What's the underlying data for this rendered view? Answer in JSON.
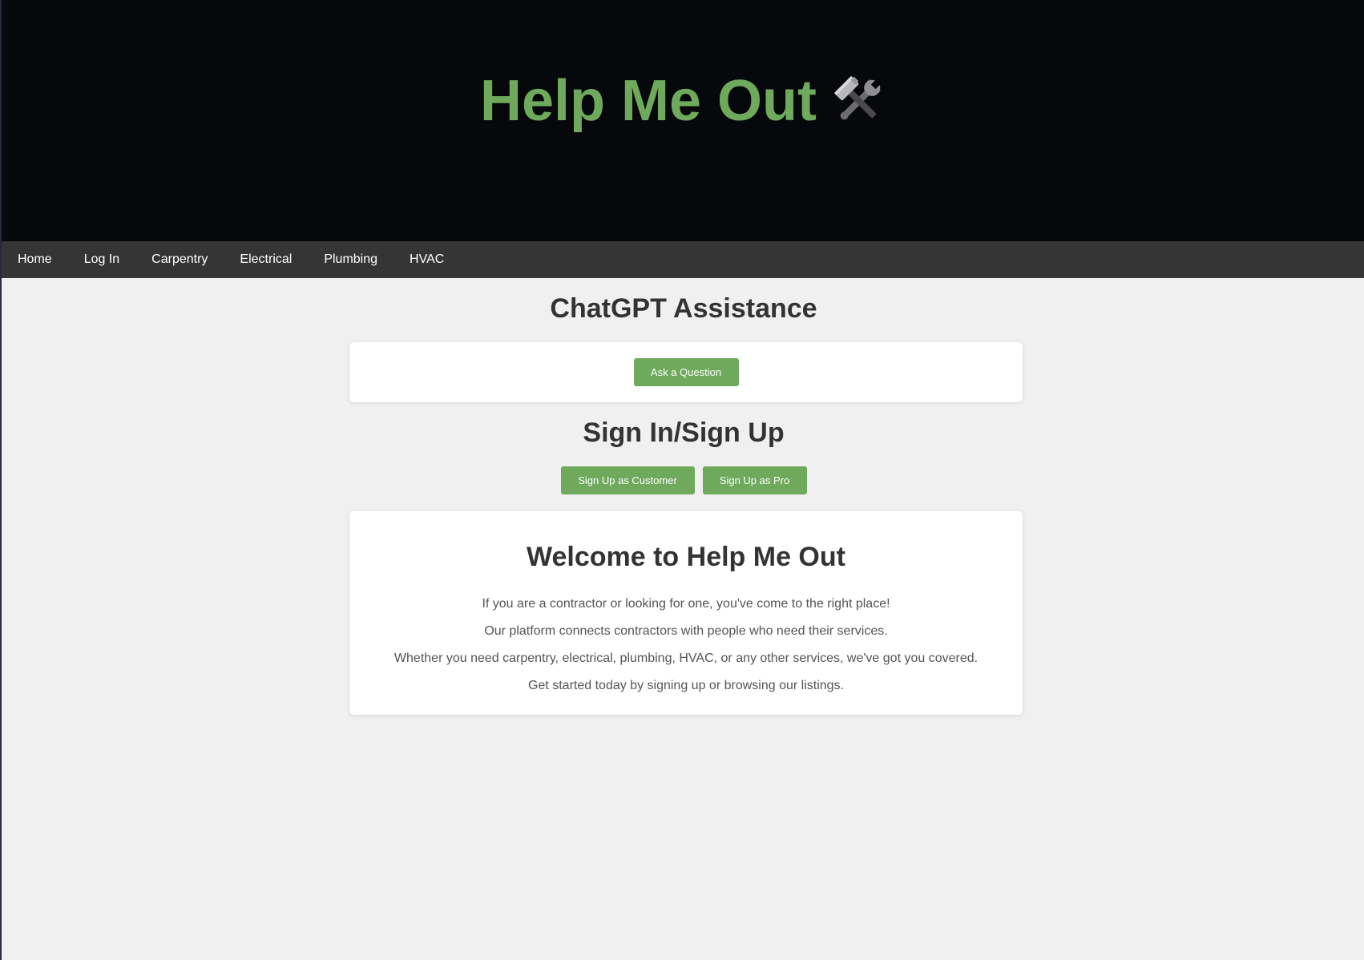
{
  "hero": {
    "title": "Help Me Out",
    "icon": "hammer-and-wrench-icon"
  },
  "nav": {
    "items": [
      {
        "label": "Home"
      },
      {
        "label": "Log In"
      },
      {
        "label": "Carpentry"
      },
      {
        "label": "Electrical"
      },
      {
        "label": "Plumbing"
      },
      {
        "label": "HVAC"
      }
    ]
  },
  "chat": {
    "title": "ChatGPT Assistance",
    "ask_label": "Ask a Question"
  },
  "signup": {
    "title": "Sign In/Sign Up",
    "customer_label": "Sign Up as Customer",
    "pro_label": "Sign Up as Pro"
  },
  "welcome": {
    "title": "Welcome to Help Me Out",
    "lines": [
      "If you are a contractor or looking for one, you've come to the right place!",
      "Our platform connects contractors with people who need their services.",
      "Whether you need carpentry, electrical, plumbing, HVAC, or any other services, we've got you covered.",
      "Get started today by signing up or browsing our listings."
    ]
  },
  "colors": {
    "accent": "#6ea95c",
    "hero_bg": "#07080b",
    "nav_bg": "#353535",
    "page_bg": "#f0f0f0"
  }
}
